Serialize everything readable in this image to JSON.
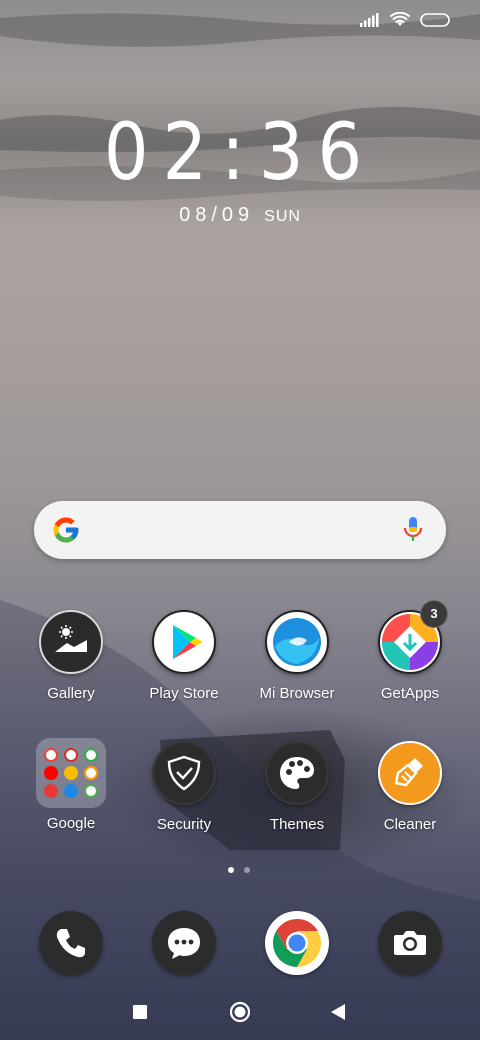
{
  "status": {
    "signal": "signal-icon",
    "wifi": "wifi-icon",
    "battery": "battery-icon"
  },
  "clock": {
    "time": "02:36",
    "date": "08/09",
    "day": "SUN"
  },
  "search": {
    "logo": "google-g-icon",
    "mic": "microphone-icon"
  },
  "apps": [
    {
      "label": "Gallery",
      "icon": "gallery-icon"
    },
    {
      "label": "Play Store",
      "icon": "play-store-icon"
    },
    {
      "label": "Mi Browser",
      "icon": "mi-browser-icon"
    },
    {
      "label": "GetApps",
      "icon": "getapps-icon",
      "badge": "3"
    },
    {
      "label": "Google",
      "icon": "google-folder-icon"
    },
    {
      "label": "Security",
      "icon": "security-shield-icon"
    },
    {
      "label": "Themes",
      "icon": "themes-palette-icon"
    },
    {
      "label": "Cleaner",
      "icon": "cleaner-brush-icon"
    }
  ],
  "page_indicator": {
    "pages": 2,
    "current": 1
  },
  "dock": [
    {
      "icon": "phone-icon"
    },
    {
      "icon": "messages-icon"
    },
    {
      "icon": "chrome-icon"
    },
    {
      "icon": "camera-icon"
    }
  ],
  "nav": {
    "recents": "recents-icon",
    "home": "home-icon",
    "back": "back-icon"
  },
  "colors": {
    "cleaner": "#f39a1e",
    "badge": "#3a3a3a",
    "search_bg": "#f4f3f4"
  }
}
